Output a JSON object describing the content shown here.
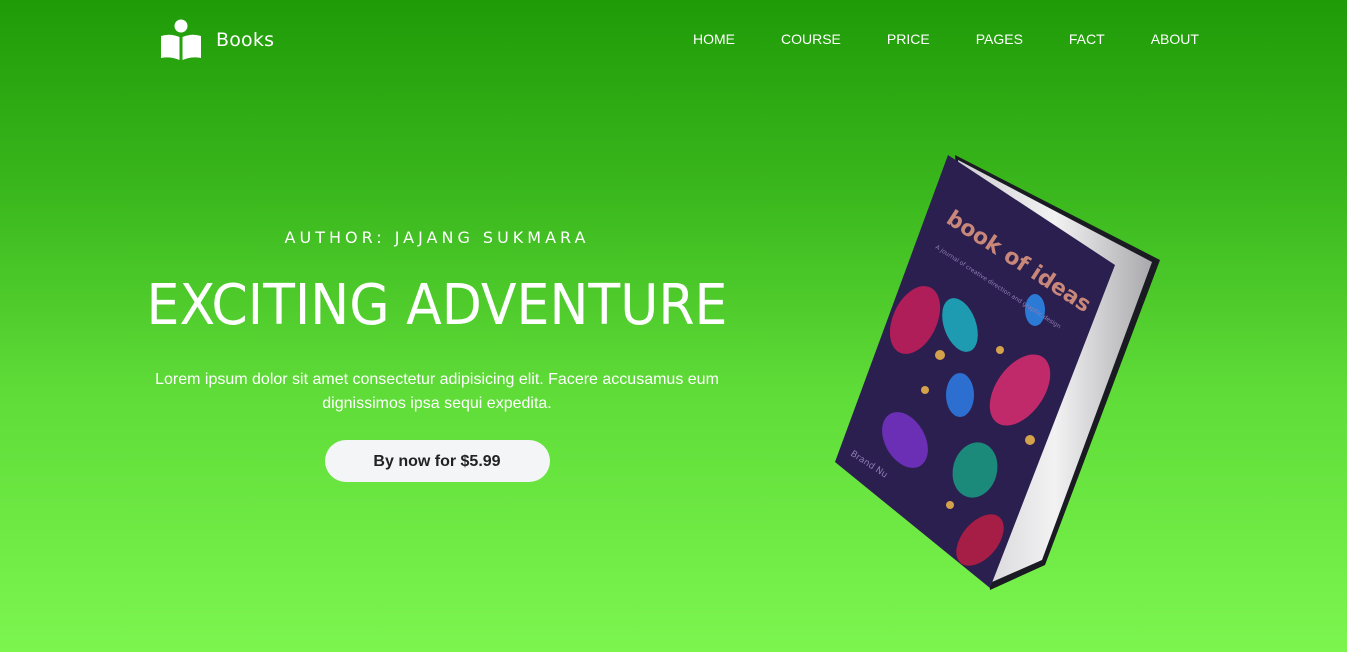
{
  "brand": {
    "name": "Books"
  },
  "nav": {
    "items": [
      "HOME",
      "COURSE",
      "PRICE",
      "PAGES",
      "FACT",
      "ABOUT"
    ]
  },
  "hero": {
    "author": "AUTHOR: JAJANG SUKMARA",
    "title": "EXCITING ADVENTURE",
    "description": "Lorem ipsum dolor sit amet consectetur adipisicing elit. Facere accusamus eum dignissimos ipsa sequi expedita.",
    "cta": "By now for $5.99"
  },
  "book_cover": {
    "title": "book of ideas",
    "subtitle": "A journal of creative direction and graphic design",
    "author": "Brand Nu"
  },
  "colors": {
    "bg_top": "#1f9b08",
    "bg_bottom": "#7cf54f",
    "cover": "#2a1f4e",
    "cover_title": "#c9877a"
  }
}
